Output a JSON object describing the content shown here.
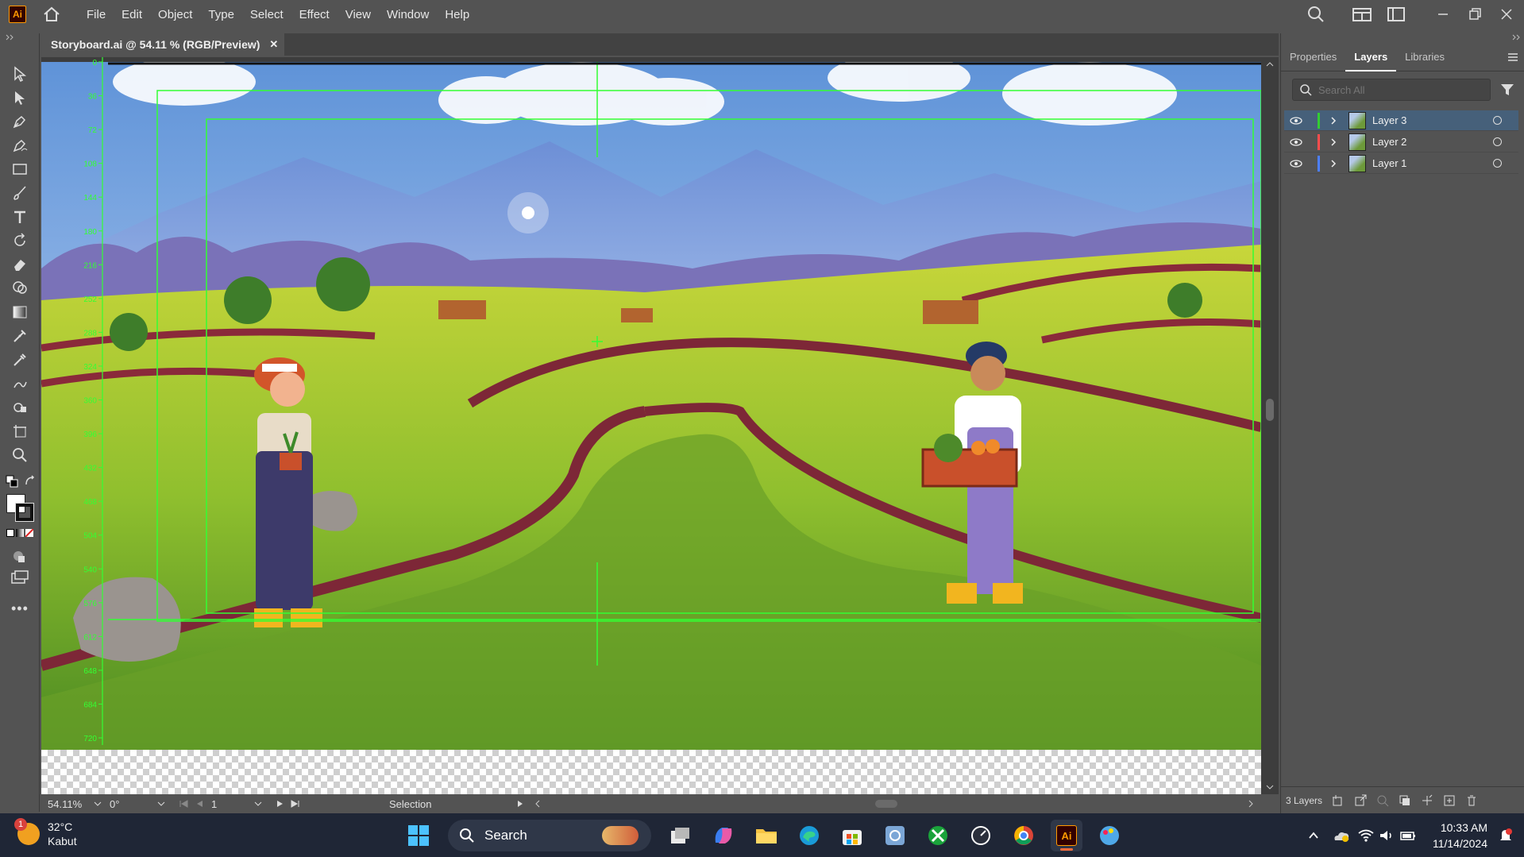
{
  "app": {
    "logo_text": "Ai",
    "menus": [
      "File",
      "Edit",
      "Object",
      "Type",
      "Select",
      "Effect",
      "View",
      "Window",
      "Help"
    ]
  },
  "document": {
    "tab_title": "Storyboard.ai @ 54.11 % (RGB/Preview)",
    "close_glyph": "✕"
  },
  "ruler": {
    "ticks": [
      "0",
      "36",
      "72",
      "108",
      "144",
      "180",
      "216",
      "252",
      "288",
      "324",
      "360",
      "396",
      "432",
      "468",
      "504",
      "540",
      "576",
      "612",
      "648",
      "684",
      "720"
    ],
    "color": "#33ff33"
  },
  "statusbar": {
    "zoom": "54.11%",
    "rotation": "0°",
    "artboard_number": "1",
    "tool_name": "Selection"
  },
  "panel": {
    "tabs": [
      "Properties",
      "Layers",
      "Libraries"
    ],
    "active_tab": "Layers",
    "search_placeholder": "Search All",
    "layers": [
      {
        "name": "Layer 3",
        "color": "#33cc33",
        "selected": true
      },
      {
        "name": "Layer 2",
        "color": "#ff4d4d",
        "selected": false
      },
      {
        "name": "Layer 1",
        "color": "#4d7fff",
        "selected": false
      }
    ],
    "footer_count": "3 Layers"
  },
  "taskbar": {
    "weather_temp": "32°C",
    "weather_desc": "Kabut",
    "weather_badge": "1",
    "search_label": "Search",
    "time": "10:33 AM",
    "date": "11/14/2024"
  },
  "colors": {
    "ui_bg": "#535353",
    "guide_green": "#33ff33",
    "accent_orange": "#ff9a00"
  }
}
